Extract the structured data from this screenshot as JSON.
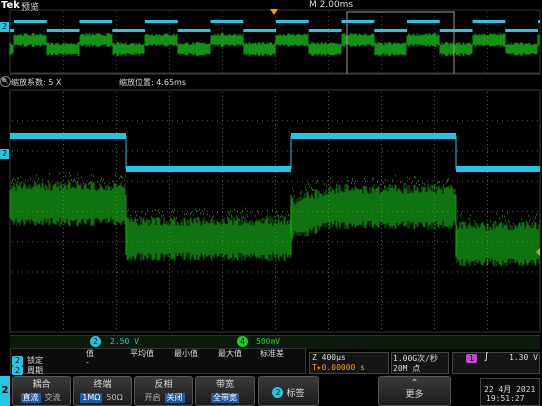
{
  "header": {
    "brand": "Tek",
    "mode": "预览",
    "timebase": "M 2.00ms",
    "trigger_marker": "T"
  },
  "zoom_bar": {
    "factor": "缩放系数: 5 X",
    "position": "缩放位置: 4.65ms"
  },
  "channels": {
    "ch1_marker": "2",
    "ch2_marker": "2"
  },
  "channel_readout": {
    "ch2_num": "2",
    "ch2_scale": "2.50 V",
    "ch4_num": "4",
    "ch4_scale": "500mV"
  },
  "measurement": {
    "locked_badge": "2",
    "locked_label": "锁定",
    "period_badge": "2",
    "period_label": "周期",
    "headers": [
      "值",
      "平均值",
      "最小值",
      "最大值",
      "标准差"
    ],
    "dash": "-"
  },
  "horizontal": {
    "zoom_scale": "Z 400µs",
    "trig_pos": "T▸0.00000 s",
    "sample_rate": "1.00G次/秒",
    "record_length": "20M 点"
  },
  "trigger": {
    "source": "1",
    "slope": "∫",
    "level": "1.30 V"
  },
  "bottom_menu": {
    "ch_tab": "2",
    "coupling": {
      "label": "耦合",
      "options": [
        "直流",
        "交流"
      ],
      "selected": 0
    },
    "termination": {
      "label": "终端",
      "options": [
        "1MΩ",
        "50Ω"
      ],
      "selected": 0
    },
    "invert": {
      "label": "反相",
      "options": [
        "开启",
        "关闭"
      ],
      "selected": 1
    },
    "bandwidth": {
      "label": "带宽",
      "value": "全带宽"
    },
    "label_btn": {
      "badge": "2",
      "label": "标签"
    },
    "more": {
      "label": "更多"
    }
  },
  "datetime": {
    "date": "22 4月 2021",
    "time": "19:51:27"
  },
  "colors": {
    "ch2_cyan": "#23c7e6",
    "ch4_green": "#1bd11b",
    "trigger_orange": "#f39b1a",
    "menu_blue": "#1f5aa0"
  }
}
